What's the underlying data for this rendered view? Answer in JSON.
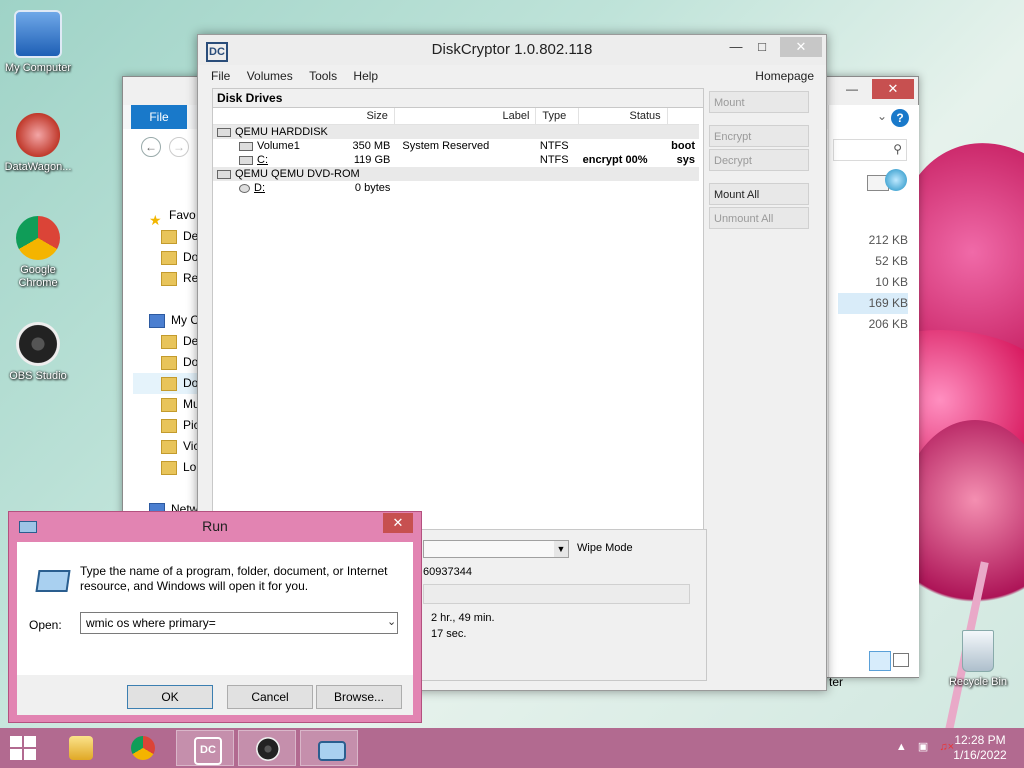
{
  "desktop": {
    "icons": [
      {
        "label": "My Computer"
      },
      {
        "label": "DataWagon..."
      },
      {
        "label": "Google Chrome"
      },
      {
        "label": "OBS Studio"
      }
    ],
    "recycle_bin": "Recycle Bin"
  },
  "explorer": {
    "file_tab": "File",
    "nav_items": [
      "Favo",
      "De",
      "Do",
      "Re",
      "My C",
      "De",
      "Do",
      "Do",
      "Mu",
      "Pic",
      "Vic",
      "Lo",
      "Netw"
    ],
    "sizes": [
      "212 KB",
      "52 KB",
      "10 KB",
      "169 KB",
      "206 KB"
    ],
    "status_fragment": "ter"
  },
  "diskcryptor": {
    "title": "DiskCryptor 1.0.802.118",
    "menu": [
      "File",
      "Volumes",
      "Tools",
      "Help"
    ],
    "homepage": "Homepage",
    "panel_title": "Disk Drives",
    "columns": [
      "Size",
      "Label",
      "Type",
      "Status"
    ],
    "devices": [
      {
        "name": "QEMU HARDDISK",
        "volumes": [
          {
            "name": "Volume1",
            "size": "350 MB",
            "label": "System Reserved",
            "type": "NTFS",
            "status": "",
            "flag": "boot"
          },
          {
            "name": "C:",
            "size": "119 GB",
            "label": "",
            "type": "NTFS",
            "status": "encrypt 00%",
            "flag": "sys"
          }
        ]
      },
      {
        "name": "QEMU QEMU DVD-ROM",
        "volumes": [
          {
            "name": "D:",
            "size": "0 bytes",
            "label": "",
            "type": "",
            "status": "",
            "flag": ""
          }
        ]
      }
    ],
    "buttons": {
      "mount": "Mount",
      "encrypt": "Encrypt",
      "decrypt": "Decrypt",
      "mount_all": "Mount All",
      "unmount_all": "Unmount All"
    },
    "wipe_mode_label": "Wipe Mode",
    "serial": "60937344",
    "time_elapsed": "2 hr., 49 min.",
    "time_left": "17 sec."
  },
  "run": {
    "title": "Run",
    "description": "Type the name of a program, folder, document, or Internet resource, and Windows will open it for you.",
    "open_label": "Open:",
    "input_value": "wmic os where primary=",
    "ok": "OK",
    "cancel": "Cancel",
    "browse": "Browse..."
  },
  "taskbar": {
    "time": "12:28 PM",
    "date": "1/16/2022"
  }
}
